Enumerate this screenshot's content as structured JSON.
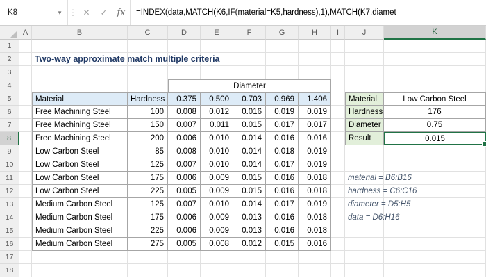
{
  "formula_bar": {
    "name_box": "K8",
    "formula": "=INDEX(data,MATCH(K6,IF(material=K5,hardness),1),MATCH(K7,diamet",
    "icons": {
      "dropdown": "▼",
      "dots": "⋮",
      "cancel": "✕",
      "enter": "✓",
      "fx": "fx"
    }
  },
  "selection": {
    "column": "K",
    "row": "8"
  },
  "grid": {
    "column_headers": [
      "A",
      "B",
      "C",
      "D",
      "E",
      "F",
      "G",
      "H",
      "I",
      "J",
      "K"
    ],
    "row_headers": [
      "1",
      "2",
      "3",
      "4",
      "5",
      "6",
      "7",
      "8",
      "9",
      "10",
      "11",
      "12",
      "13",
      "14",
      "15",
      "16",
      "17",
      "18"
    ]
  },
  "title": "Two-way approximate match multiple criteria",
  "table": {
    "diameter_header": "Diameter",
    "headers": [
      "Material",
      "Hardness",
      "0.375",
      "0.500",
      "0.703",
      "0.969",
      "1.406"
    ],
    "rows": [
      [
        "Free Machining Steel",
        "100",
        "0.008",
        "0.012",
        "0.016",
        "0.019",
        "0.019"
      ],
      [
        "Free Machining Steel",
        "150",
        "0.007",
        "0.011",
        "0.015",
        "0.017",
        "0.017"
      ],
      [
        "Free Machining Steel",
        "200",
        "0.006",
        "0.010",
        "0.014",
        "0.016",
        "0.016"
      ],
      [
        "Low Carbon Steel",
        "85",
        "0.008",
        "0.010",
        "0.014",
        "0.018",
        "0.019"
      ],
      [
        "Low Carbon Steel",
        "125",
        "0.007",
        "0.010",
        "0.014",
        "0.017",
        "0.019"
      ],
      [
        "Low Carbon Steel",
        "175",
        "0.006",
        "0.009",
        "0.015",
        "0.016",
        "0.018"
      ],
      [
        "Low Carbon Steel",
        "225",
        "0.005",
        "0.009",
        "0.015",
        "0.016",
        "0.018"
      ],
      [
        "Medium Carbon Steel",
        "125",
        "0.007",
        "0.010",
        "0.014",
        "0.017",
        "0.019"
      ],
      [
        "Medium Carbon Steel",
        "175",
        "0.006",
        "0.009",
        "0.013",
        "0.016",
        "0.018"
      ],
      [
        "Medium Carbon Steel",
        "225",
        "0.006",
        "0.009",
        "0.013",
        "0.016",
        "0.018"
      ],
      [
        "Medium Carbon Steel",
        "275",
        "0.005",
        "0.008",
        "0.012",
        "0.015",
        "0.016"
      ]
    ]
  },
  "lookup": {
    "rows": [
      {
        "label": "Material",
        "value": "Low Carbon Steel"
      },
      {
        "label": "Hardness",
        "value": "176"
      },
      {
        "label": "Diameter",
        "value": "0.75"
      },
      {
        "label": "Result",
        "value": "0.015"
      }
    ]
  },
  "notes": [
    "material = B6:B16",
    "hardness = C6:C16",
    "diameter = D5:H5",
    "data = D6:H16"
  ],
  "colors": {
    "accent_green": "#217346",
    "table_header_fill": "#DDEBF7",
    "lookup_label_fill": "#E2EFDA",
    "title_color": "#1F3864"
  }
}
